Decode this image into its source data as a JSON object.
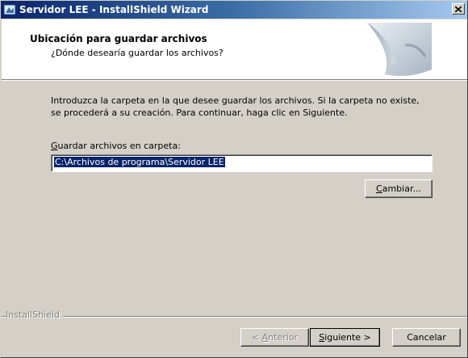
{
  "window": {
    "title": "Servidor LEE - InstallShield Wizard",
    "close_label": "×"
  },
  "header": {
    "title": "Ubicación para guardar archivos",
    "subtitle": "¿Dónde desearía guardar los archivos?"
  },
  "body": {
    "instructions_line1": "Introduzca la carpeta en la que desee guardar los archivos.  Si la carpeta no existe,",
    "instructions_line2": "se procederá a su creación.  Para continuar, haga clic en Siguiente.",
    "folder_label_mnemonic": "G",
    "folder_label_rest": "uardar archivos en carpeta:",
    "folder_value": "C:\\Archivos de programa\\Servidor LEE",
    "change_mnemonic": "C",
    "change_rest": "ambiar..."
  },
  "footer": {
    "brand": "InstallShield",
    "back_prefix": "< ",
    "back_mnemonic": "A",
    "back_rest": "nterior",
    "next_mnemonic": "S",
    "next_rest": "iguiente >",
    "cancel_label": "Cancelar"
  },
  "colors": {
    "titlebar_start": "#0a246a",
    "titlebar_end": "#a6caf0",
    "dialog_bg": "#d4d0c8",
    "selection": "#0a246a"
  },
  "icons": {
    "app": "installshield-app-icon",
    "close": "close-icon",
    "header_graphic": "folder-wizard-graphic"
  }
}
